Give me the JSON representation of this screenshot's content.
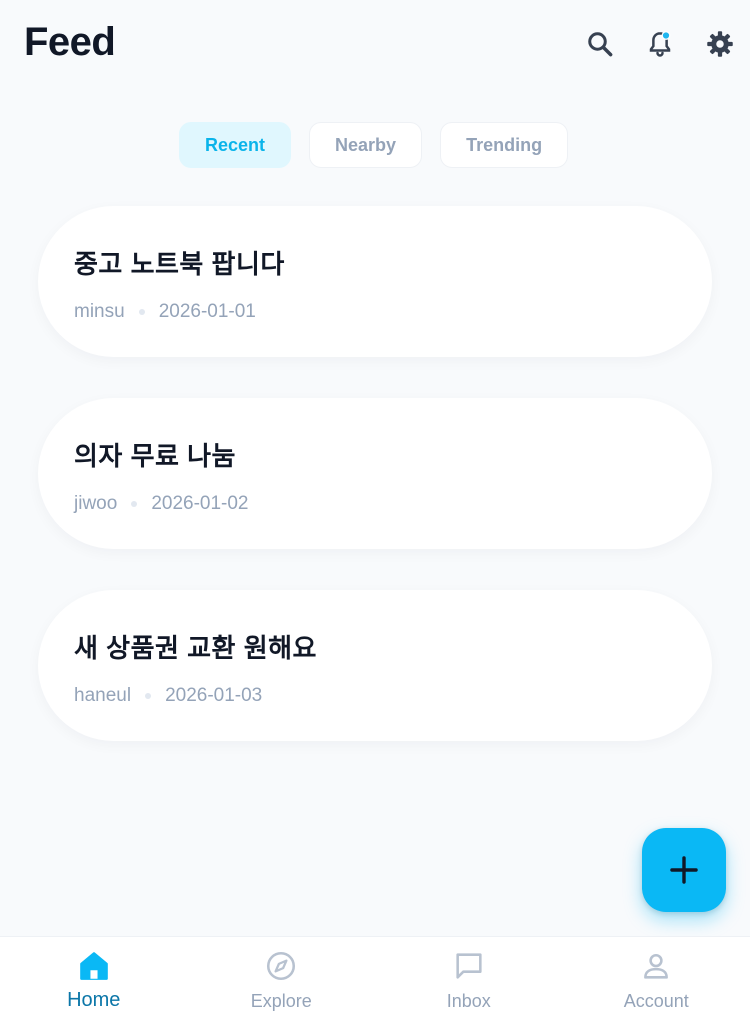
{
  "header": {
    "title": "Feed",
    "icons": [
      "search-icon",
      "bell-icon",
      "gear-icon"
    ]
  },
  "tabs": [
    {
      "label": "Recent",
      "active": true
    },
    {
      "label": "Nearby",
      "active": false
    },
    {
      "label": "Trending",
      "active": false
    }
  ],
  "posts": [
    {
      "title": "중고 노트북 팝니다",
      "author": "minsu",
      "date": "2026-01-01"
    },
    {
      "title": "의자 무료 나눔",
      "author": "jiwoo",
      "date": "2026-01-02"
    },
    {
      "title": "새 상품권 교환 원해요",
      "author": "haneul",
      "date": "2026-01-03"
    }
  ],
  "fab": {
    "icon": "plus-icon"
  },
  "nav": [
    {
      "label": "Home",
      "icon": "home-icon",
      "active": true
    },
    {
      "label": "Explore",
      "icon": "compass-icon",
      "active": false
    },
    {
      "label": "Inbox",
      "icon": "message-icon",
      "active": false
    },
    {
      "label": "Account",
      "icon": "user-icon",
      "active": false
    }
  ],
  "colors": {
    "accent": "#0ab8f5",
    "accent_text": "#0ab4ea",
    "active_nav": "#0b76a8",
    "muted": "#94a3b8",
    "notification_dot": "#1fb6ef"
  }
}
